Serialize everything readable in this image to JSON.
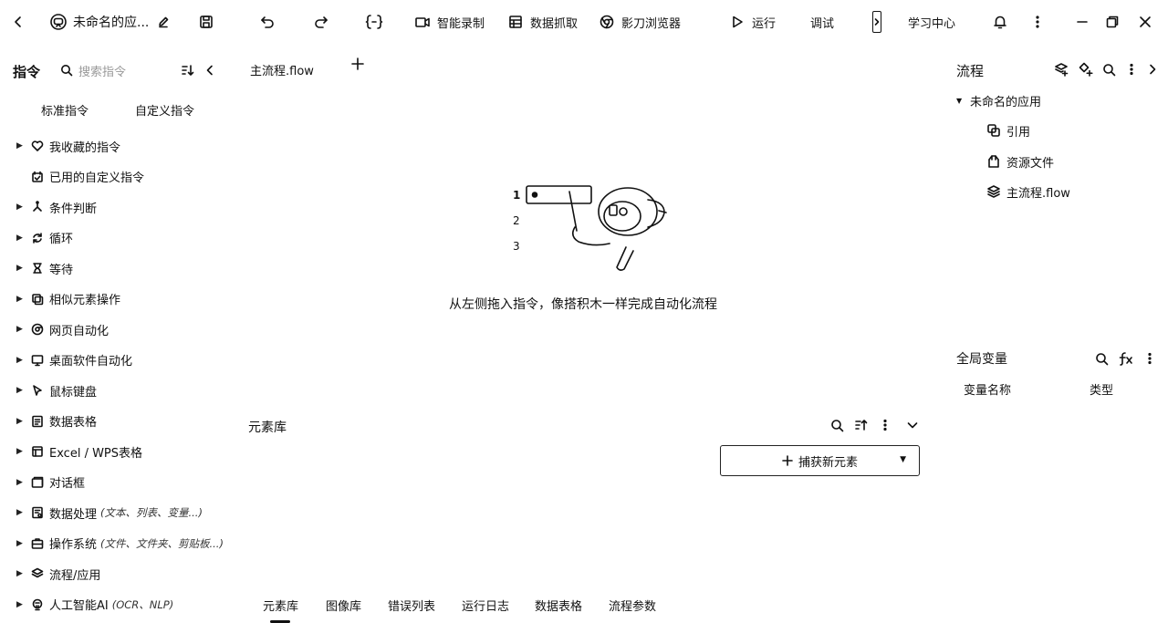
{
  "toolbar": {
    "app_title": "未命名的应...",
    "smart_record": "智能录制",
    "data_capture": "数据抓取",
    "browser": "影刀浏览器",
    "run": "运行",
    "debug": "调试",
    "learning_center": "学习中心"
  },
  "left_panel": {
    "title": "指令",
    "search_placeholder": "搜索指令",
    "tabs": [
      "标准指令",
      "自定义指令"
    ],
    "categories": [
      {
        "label": "我收藏的指令",
        "hint": "",
        "icon": "heart-icon",
        "expandable": true
      },
      {
        "label": "已用的自定义指令",
        "hint": "",
        "icon": "calendar-check-icon",
        "expandable": false
      },
      {
        "label": "条件判断",
        "hint": "",
        "icon": "branch-icon",
        "expandable": true
      },
      {
        "label": "循环",
        "hint": "",
        "icon": "loop-icon",
        "expandable": true
      },
      {
        "label": "等待",
        "hint": "",
        "icon": "hourglass-icon",
        "expandable": true
      },
      {
        "label": "相似元素操作",
        "hint": "",
        "icon": "copy-elements-icon",
        "expandable": true
      },
      {
        "label": "网页自动化",
        "hint": "",
        "icon": "chrome-icon",
        "expandable": true
      },
      {
        "label": "桌面软件自动化",
        "hint": "",
        "icon": "monitor-icon",
        "expandable": true
      },
      {
        "label": "鼠标键盘",
        "hint": "",
        "icon": "cursor-icon",
        "expandable": true
      },
      {
        "label": "数据表格",
        "hint": "",
        "icon": "sheet-icon",
        "expandable": true
      },
      {
        "label": "Excel / WPS表格",
        "hint": "",
        "icon": "excel-icon",
        "expandable": true
      },
      {
        "label": "对话框",
        "hint": "",
        "icon": "dialog-icon",
        "expandable": true
      },
      {
        "label": "数据处理",
        "hint": "(文本、列表、变量...)",
        "icon": "data-process-icon",
        "expandable": true
      },
      {
        "label": "操作系统",
        "hint": "(文件、文件夹、剪贴板...)",
        "icon": "os-icon",
        "expandable": true
      },
      {
        "label": "流程/应用",
        "hint": "",
        "icon": "layers-icon",
        "expandable": true
      },
      {
        "label": "人工智能AI",
        "hint": "(OCR、NLP)",
        "icon": "ai-brain-icon",
        "expandable": true
      }
    ]
  },
  "center": {
    "flow_tab": "主流程.flow",
    "empty_text": "从左侧拖入指令，像搭积木一样完成自动化流程",
    "illustration_numbers": [
      "1",
      "2",
      "3"
    ],
    "element_library_title": "元素库",
    "capture_button": "捕获新元素",
    "bottom_tabs": [
      "元素库",
      "图像库",
      "错误列表",
      "运行日志",
      "数据表格",
      "流程参数"
    ]
  },
  "right_panel": {
    "title": "流程",
    "app_node": "未命名的应用",
    "tree": [
      {
        "label": "引用",
        "icon": "reference-icon"
      },
      {
        "label": "资源文件",
        "icon": "resource-file-icon"
      },
      {
        "label": "主流程.flow",
        "icon": "flow-file-icon"
      }
    ],
    "variables_title": "全局变量",
    "variable_columns": [
      "变量名称",
      "类型"
    ]
  }
}
